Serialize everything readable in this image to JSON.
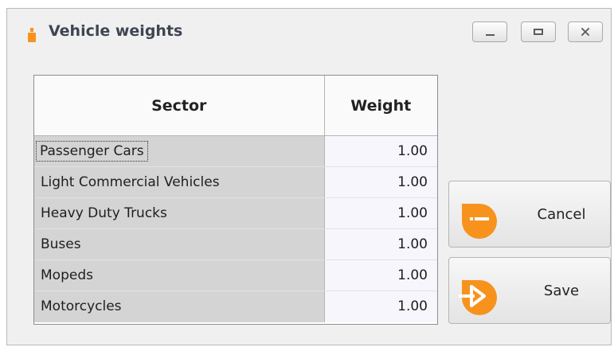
{
  "window": {
    "title": "Vehicle weights",
    "controls": {
      "minimize": "minimize-icon",
      "maximize": "maximize-icon",
      "close": "close-icon"
    }
  },
  "grid": {
    "columns": [
      "Sector",
      "Weight"
    ],
    "rows": [
      {
        "sector": "Passenger Cars",
        "weight": "1.00"
      },
      {
        "sector": "Light Commercial Vehicles",
        "weight": "1.00"
      },
      {
        "sector": "Heavy Duty Trucks",
        "weight": "1.00"
      },
      {
        "sector": "Buses",
        "weight": "1.00"
      },
      {
        "sector": "Mopeds",
        "weight": "1.00"
      },
      {
        "sector": "Motorcycles",
        "weight": "1.00"
      }
    ],
    "selected_row": 0
  },
  "buttons": {
    "cancel": {
      "label": "Cancel",
      "icon": "cancel-icon"
    },
    "save": {
      "label": "Save",
      "icon": "save-icon"
    }
  },
  "colors": {
    "accent": "#f7931d",
    "title": "#3f4551",
    "sector_bg": "#d4d4d4",
    "weight_bg": "#f7f6fc"
  }
}
